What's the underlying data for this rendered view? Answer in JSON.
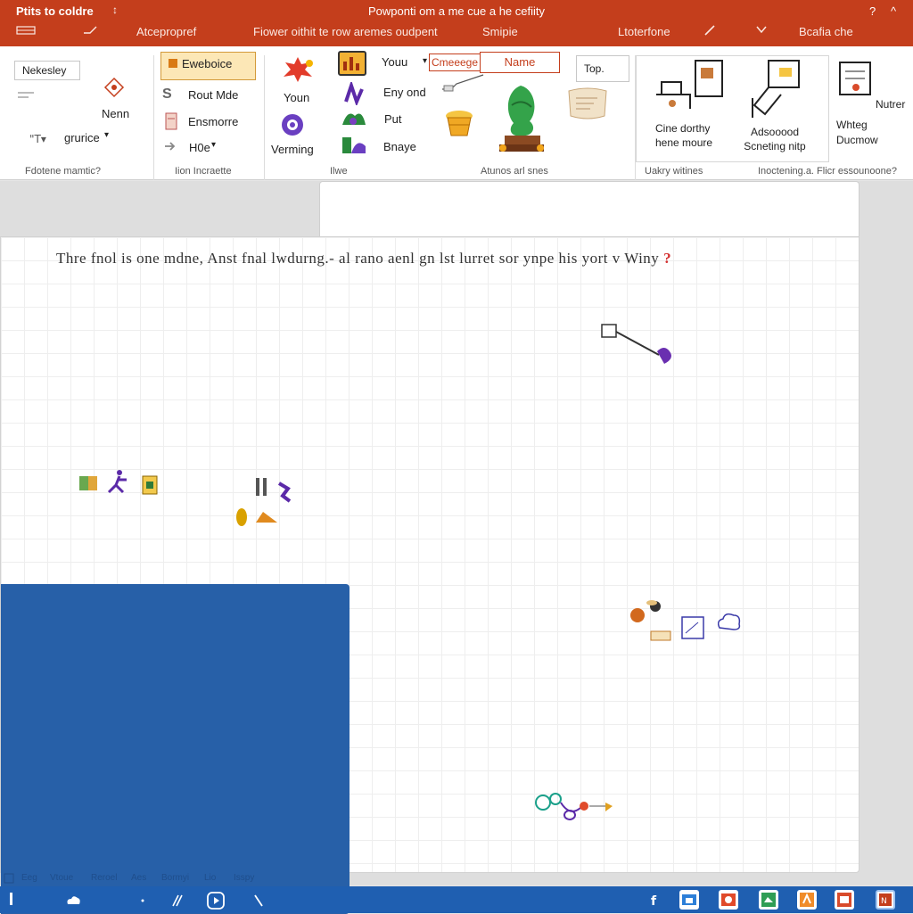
{
  "titlebar": {
    "app_left": "Ptits to coldre",
    "doc_title": "Powponti om a me cue a he cefiity",
    "help_glyph": "?",
    "minimize_glyph": "^",
    "qat_glyphs": [
      "↕",
      "\\"
    ],
    "accent_color": "#c43e1c"
  },
  "tabs": [
    "Atcepropref",
    "Fiower oithit te row aremes oudpent",
    "Smipie",
    "Ltoterfone",
    "Bcafia che"
  ],
  "ribbon": {
    "group1": {
      "style_box": "Nekesley",
      "nenn": "Nenn",
      "font_dropdown": "grurice",
      "label": "Fdotene mamtic?"
    },
    "group2": {
      "active_button": "Eweboice",
      "items": [
        "Rout Mde",
        "Ensmorre",
        "H0e"
      ],
      "label": "Iion Incraette"
    },
    "group3": {
      "items": [
        "Youn",
        "Verming"
      ],
      "label": "Ilwe"
    },
    "group4": {
      "items": [
        "Youu",
        "Eny ond",
        "Put",
        "Bnaye"
      ],
      "dropdown": "Cmeeege",
      "name_box": "Name",
      "top_box": "Top.",
      "label": "Atunos arl snes"
    },
    "group5": {
      "items": [
        "Cine dorthy hene moure",
        "Adsooood Scneting nitp"
      ],
      "label": "Uakry witines"
    },
    "group6": {
      "items": [
        "Nutrer",
        "Whteg Ducmow"
      ],
      "label": "Inoctening.a. Flicr essounoone?"
    }
  },
  "document": {
    "heading": "Thre fnol is one mdne,  Anst  fnal  lwdurng.-  al rano  aenl  gn lst lurret  sor ynpe  his yort  v Winy",
    "heading_mark": "?",
    "panel_color": "#2760a8"
  },
  "statusbar": {
    "items": [
      "Eeg",
      "Vtoue",
      "Reroel",
      "Aes",
      "Bormyi",
      "Lio",
      "Isspy"
    ],
    "color": "#1f5fb1"
  }
}
